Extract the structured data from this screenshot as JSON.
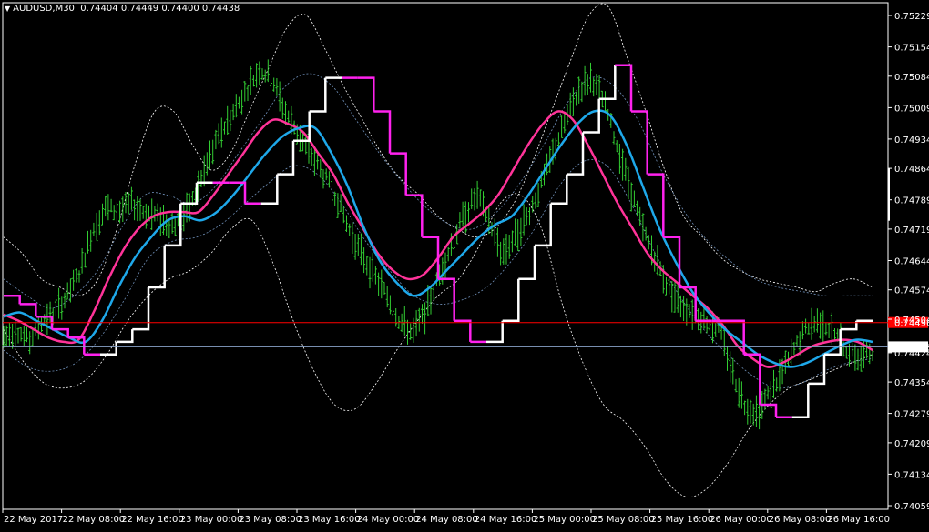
{
  "header": {
    "symbol": "AUDUSD,M30",
    "ohlc": "0.74404 0.74449 0.74400 0.74438"
  },
  "colors": {
    "background": "#000000",
    "frame": "#ffffff",
    "bars": "#32cd32",
    "slow_ma": "#ff3399",
    "fast_ma": "#1ea8ea",
    "step_up": "#ffffff",
    "step_down": "#ff22ee",
    "band": "#ffffff",
    "inner_band": "#6f8fb8",
    "red_line": "#ff0000",
    "bid_line": "#8aa3c8"
  },
  "chart_data": {
    "type": "line",
    "title": "AUDUSD,M30",
    "ylim": [
      0.74059,
      0.75229
    ],
    "y_ticks": [
      "0.75229",
      "0.75154",
      "0.75084",
      "0.75009",
      "0.74934",
      "0.74864",
      "0.74789",
      "0.74719",
      "0.74644",
      "0.74574",
      "0.74504",
      "0.74424",
      "0.74354",
      "0.74279",
      "0.74209",
      "0.74134",
      "0.74059"
    ],
    "x_ticks": [
      "22 May 2017",
      "22 May 08:00",
      "22 May 16:00",
      "23 May 00:00",
      "23 May 08:00",
      "23 May 16:00",
      "24 May 00:00",
      "24 May 08:00",
      "24 May 16:00",
      "25 May 00:00",
      "25 May 08:00",
      "25 May 16:00",
      "26 May 00:00",
      "26 May 08:00",
      "26 May 16:00"
    ],
    "price_labels": [
      {
        "value": 0.74496,
        "text": "0.74496",
        "kind": "red-line"
      },
      {
        "value": 0.74438,
        "text": "0.74438",
        "kind": "bid"
      }
    ],
    "series": [
      {
        "key": "price",
        "values": [
          0.7446,
          0.7448,
          0.7445,
          0.745,
          0.7452,
          0.7456,
          0.7462,
          0.7472,
          0.7477,
          0.7476,
          0.7478,
          0.7476,
          0.7475,
          0.7473,
          0.7474,
          0.748,
          0.7488,
          0.7495,
          0.75,
          0.7505,
          0.751,
          0.7508,
          0.75,
          0.7495,
          0.749,
          0.7485,
          0.748,
          0.7472,
          0.7466,
          0.7461,
          0.7456,
          0.745,
          0.7447,
          0.7452,
          0.746,
          0.7468,
          0.7475,
          0.748,
          0.7474,
          0.7466,
          0.747,
          0.7475,
          0.7482,
          0.749,
          0.7498,
          0.7505,
          0.7508,
          0.7502,
          0.7492,
          0.7482,
          0.7472,
          0.7465,
          0.7458,
          0.7454,
          0.7452,
          0.745,
          0.7448,
          0.7438,
          0.743,
          0.7428,
          0.7433,
          0.7438,
          0.7444,
          0.7449,
          0.745,
          0.7447,
          0.7443,
          0.7441,
          0.7443
        ]
      },
      {
        "key": "slow_ma",
        "values": [
          0.74515,
          0.745,
          0.7448,
          0.7446,
          0.7445,
          0.74455,
          0.7452,
          0.746,
          0.7467,
          0.7472,
          0.7475,
          0.7476,
          0.7476,
          0.7476,
          0.748,
          0.7485,
          0.749,
          0.7495,
          0.7498,
          0.7497,
          0.7495,
          0.749,
          0.7485,
          0.7478,
          0.7472,
          0.7466,
          0.7462,
          0.746,
          0.7461,
          0.7465,
          0.747,
          0.7473,
          0.7476,
          0.748,
          0.7486,
          0.7492,
          0.7497,
          0.75,
          0.7498,
          0.7492,
          0.7485,
          0.7478,
          0.7472,
          0.7466,
          0.7462,
          0.7459,
          0.7456,
          0.7453,
          0.7449,
          0.7444,
          0.7441,
          0.7439,
          0.744,
          0.7442,
          0.7444,
          0.7445,
          0.74455,
          0.7445,
          0.7443
        ]
      },
      {
        "key": "fast_ma",
        "values": [
          0.7451,
          0.7452,
          0.745,
          0.7448,
          0.7446,
          0.7445,
          0.745,
          0.7458,
          0.7465,
          0.747,
          0.7474,
          0.7475,
          0.7474,
          0.7476,
          0.748,
          0.7485,
          0.749,
          0.7494,
          0.7496,
          0.7496,
          0.749,
          0.7482,
          0.7472,
          0.7464,
          0.7459,
          0.7456,
          0.7458,
          0.7462,
          0.7466,
          0.747,
          0.7473,
          0.7475,
          0.748,
          0.7486,
          0.7492,
          0.7497,
          0.75,
          0.7499,
          0.7492,
          0.7482,
          0.7472,
          0.7464,
          0.7457,
          0.7452,
          0.7448,
          0.7445,
          0.7442,
          0.744,
          0.7439,
          0.744,
          0.7442,
          0.7444,
          0.74455,
          0.7445
        ]
      },
      {
        "key": "step",
        "values": [
          0.7456,
          0.7454,
          0.7451,
          0.7448,
          0.7446,
          0.7442,
          0.7442,
          0.7445,
          0.7448,
          0.7458,
          0.7468,
          0.7478,
          0.7483,
          0.7483,
          0.7483,
          0.7478,
          0.7478,
          0.7485,
          0.7493,
          0.75,
          0.7508,
          0.7508,
          0.7508,
          0.75,
          0.749,
          0.748,
          0.747,
          0.746,
          0.745,
          0.7445,
          0.7445,
          0.745,
          0.746,
          0.7468,
          0.7478,
          0.7485,
          0.7495,
          0.7503,
          0.7511,
          0.75,
          0.7485,
          0.747,
          0.7458,
          0.745,
          0.745,
          0.745,
          0.7442,
          0.743,
          0.7427,
          0.7427,
          0.7435,
          0.7442,
          0.7448,
          0.745,
          0.745
        ]
      },
      {
        "key": "upper_band",
        "values": [
          0.747,
          0.7466,
          0.746,
          0.7458,
          0.7456,
          0.746,
          0.7472,
          0.7488,
          0.75,
          0.75,
          0.7492,
          0.7486,
          0.749,
          0.75,
          0.751,
          0.752,
          0.7523,
          0.7515,
          0.7506,
          0.7498,
          0.749,
          0.7484,
          0.748,
          0.7475,
          0.7472,
          0.747,
          0.7472,
          0.7478,
          0.7488,
          0.75,
          0.7512,
          0.7523,
          0.7525,
          0.7513,
          0.75,
          0.7486,
          0.7475,
          0.747,
          0.7465,
          0.7462,
          0.746,
          0.7459,
          0.7458,
          0.7457,
          0.7459,
          0.746,
          0.7458
        ]
      },
      {
        "key": "lower_band",
        "values": [
          0.7448,
          0.744,
          0.7435,
          0.7434,
          0.7436,
          0.7442,
          0.745,
          0.7456,
          0.746,
          0.7462,
          0.7466,
          0.7472,
          0.7474,
          0.7464,
          0.745,
          0.7438,
          0.743,
          0.7429,
          0.7435,
          0.7443,
          0.745,
          0.7456,
          0.746,
          0.7468,
          0.7478,
          0.748,
          0.7472,
          0.7454,
          0.744,
          0.743,
          0.7426,
          0.742,
          0.7412,
          0.7408,
          0.741,
          0.7416,
          0.7424,
          0.743,
          0.7434,
          0.7436,
          0.7438,
          0.744,
          0.7442
        ]
      },
      {
        "key": "inner_upper",
        "values": [
          0.746,
          0.7456,
          0.7453,
          0.7456,
          0.7462,
          0.7472,
          0.748,
          0.748,
          0.7478,
          0.7482,
          0.749,
          0.7498,
          0.7506,
          0.7509,
          0.7506,
          0.7498,
          0.749,
          0.7483,
          0.7477,
          0.7473,
          0.7472,
          0.7476,
          0.7483,
          0.7492,
          0.7502,
          0.7508,
          0.7506,
          0.7498,
          0.7486,
          0.7476,
          0.7469,
          0.7464,
          0.746,
          0.7458,
          0.7457,
          0.7456,
          0.7456,
          0.7456
        ]
      },
      {
        "key": "inner_lower",
        "values": [
          0.7443,
          0.7439,
          0.7438,
          0.744,
          0.7446,
          0.7455,
          0.7465,
          0.7469,
          0.747,
          0.7473,
          0.7478,
          0.7483,
          0.7487,
          0.7485,
          0.7478,
          0.7469,
          0.7462,
          0.7456,
          0.7454,
          0.7455,
          0.7458,
          0.7464,
          0.7472,
          0.7482,
          0.7488,
          0.7487,
          0.7478,
          0.7466,
          0.7456,
          0.7448,
          0.7442,
          0.7437,
          0.7434,
          0.7435,
          0.7438,
          0.744,
          0.7441
        ]
      }
    ]
  }
}
